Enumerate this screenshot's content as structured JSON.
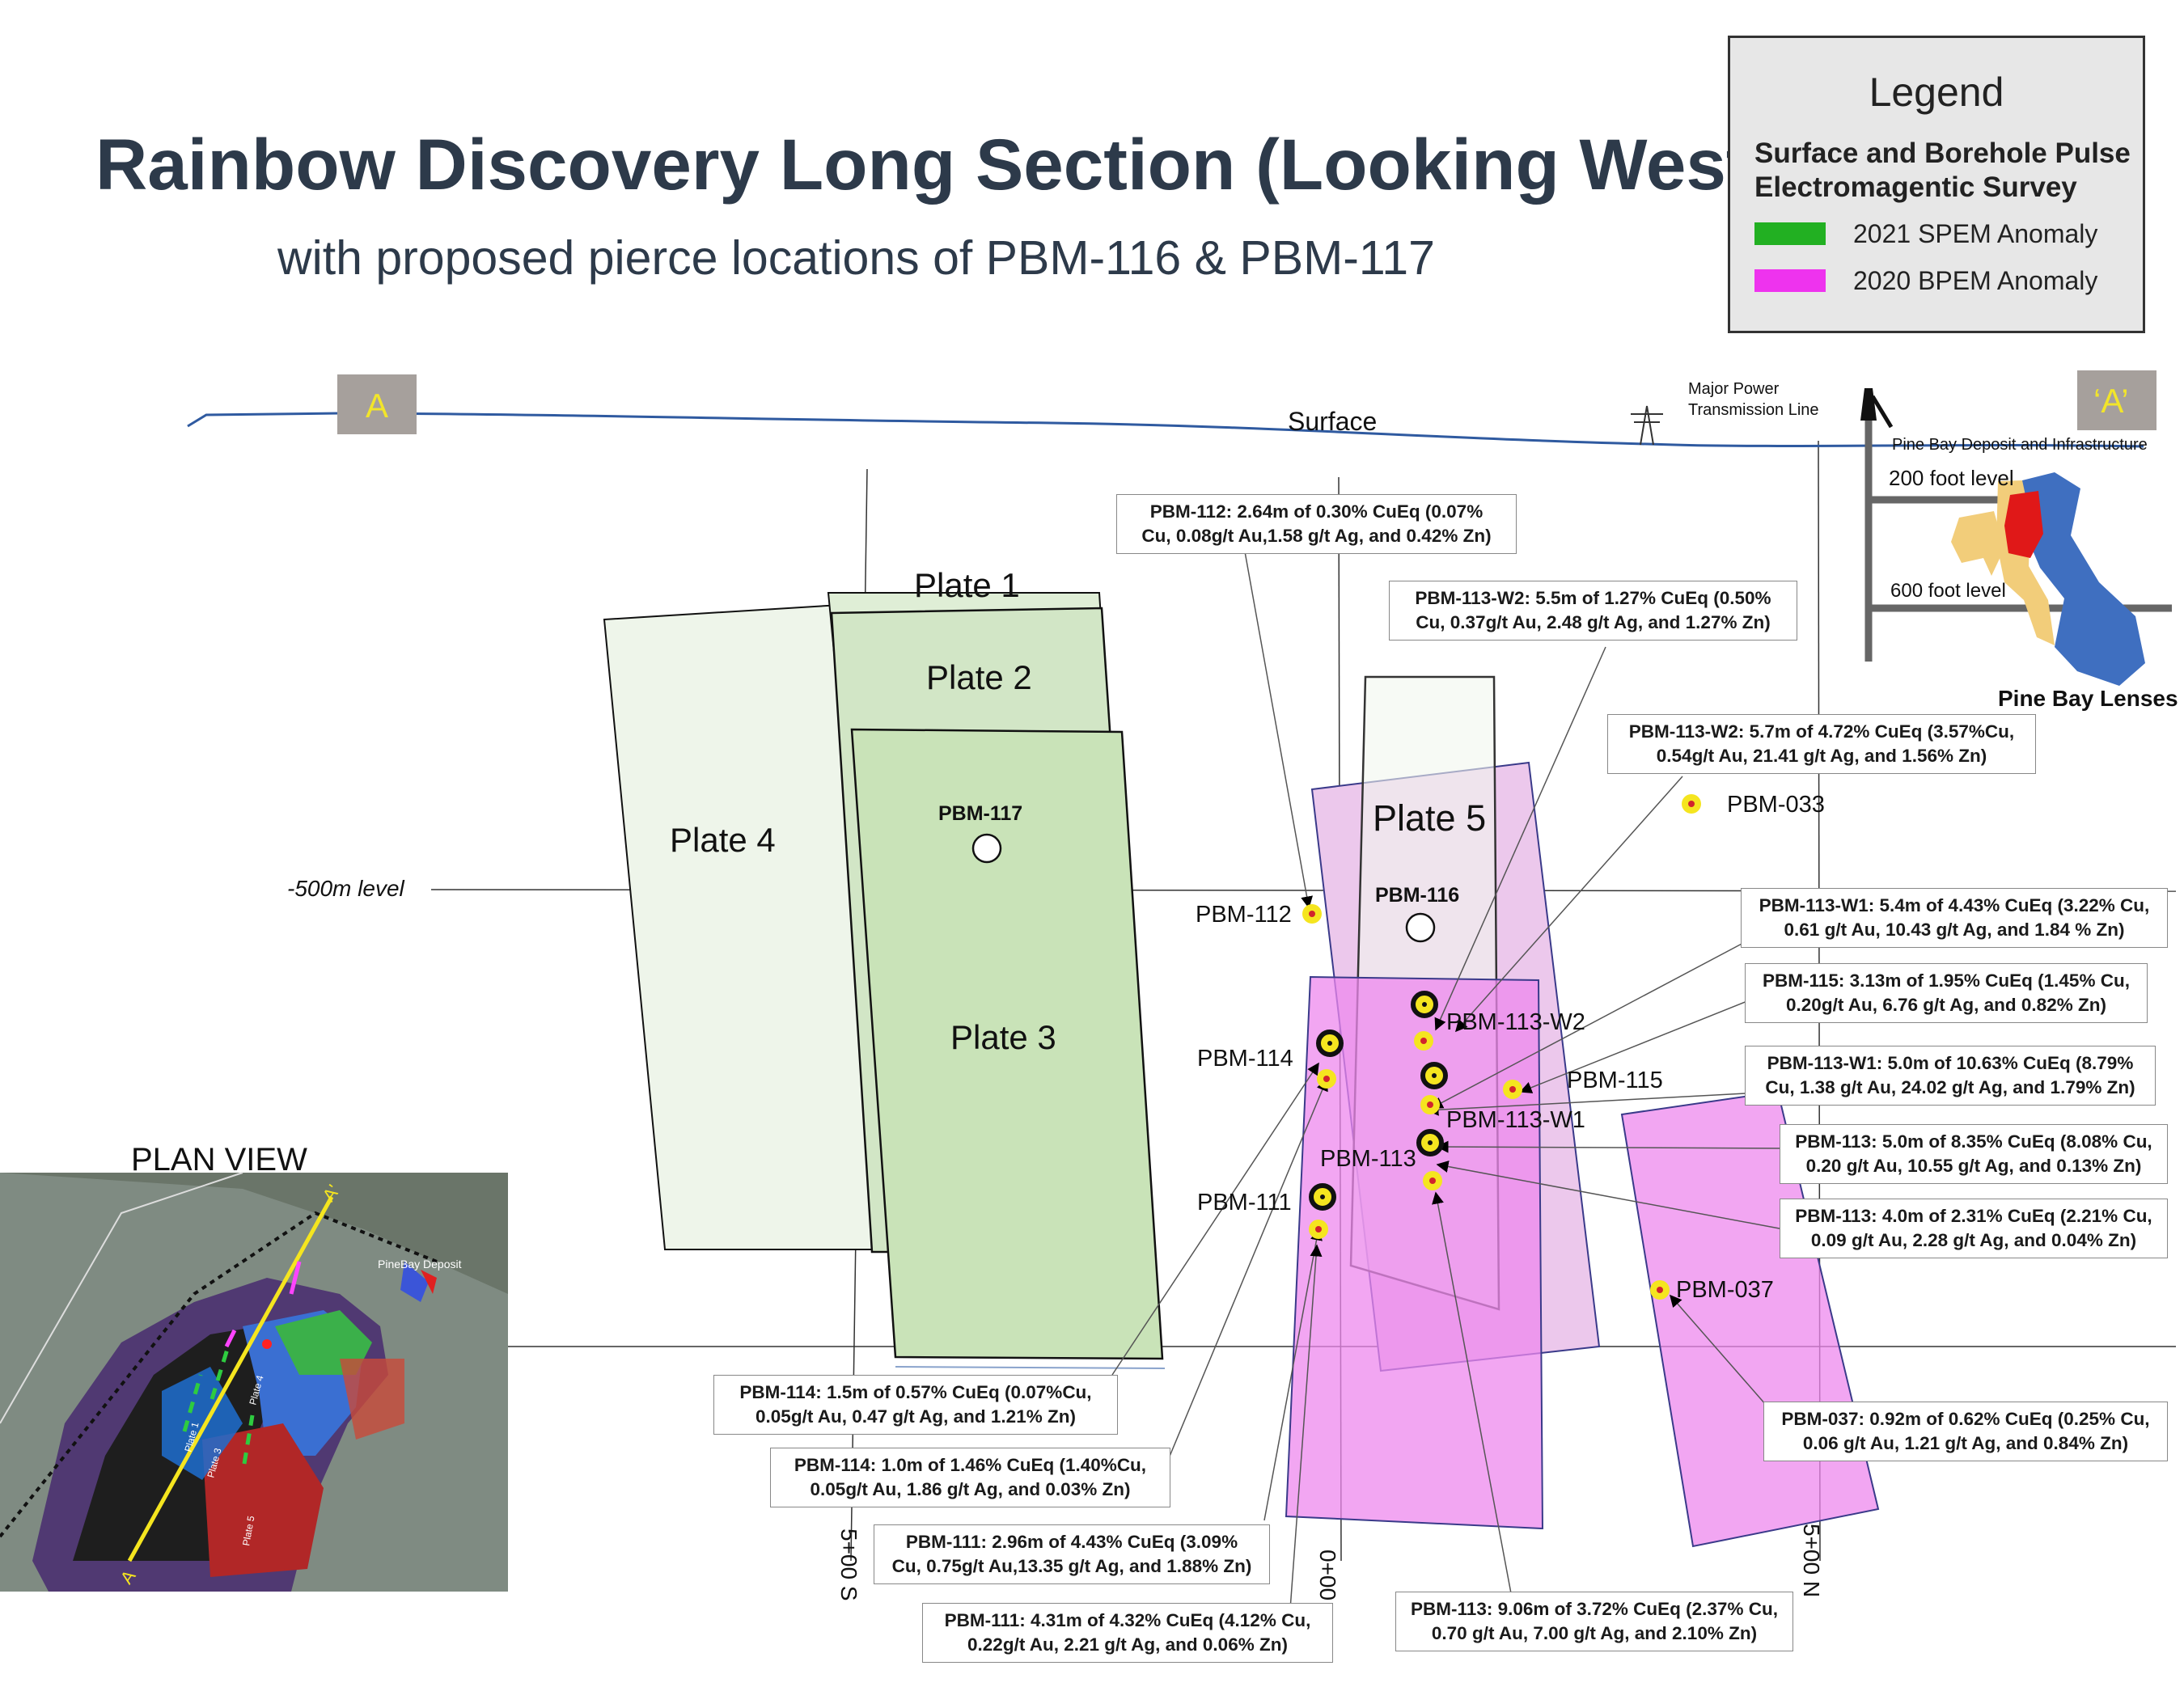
{
  "title": "Rainbow Discovery Long Section (Looking West)",
  "subtitle": "with proposed pierce locations of PBM-116 &  PBM-117",
  "legend": {
    "title": "Legend",
    "subtitle": "Surface and Borehole Pulse Electromagentic Survey",
    "items": [
      {
        "label": "2021 SPEM Anomaly",
        "color": "#22b022"
      },
      {
        "label": "2020 BPEM Anomaly",
        "color": "#ee33ee"
      }
    ]
  },
  "section": {
    "point_a": "A",
    "point_a_prime": "‘A’",
    "surface_label": "Surface",
    "power_line_label_1": "Major Power",
    "power_line_label_2": "Transmission Line",
    "level_label": "-500m level",
    "grid_labels": [
      "5+00 S",
      "0+00",
      "5+00 N"
    ]
  },
  "plates": {
    "plate1": "Plate 1",
    "plate2": "Plate 2",
    "plate3": "Plate 3",
    "plate4": "Plate 4",
    "plate5": "Plate 5"
  },
  "proposed": {
    "pbm117": "PBM-117",
    "pbm116": "PBM-116"
  },
  "holes": {
    "pbm112": "PBM-112",
    "pbm114": "PBM-114",
    "pbm111": "PBM-111",
    "pbm113": "PBM-113",
    "pbm113w2": "PBM-113-W2",
    "pbm113w1": "PBM-113-W1",
    "pbm115": "PBM-115",
    "pbm033": "PBM-033",
    "pbm037": "PBM-037"
  },
  "pine_bay": {
    "deposit_label": "Pine Bay Deposit and Infrastructure",
    "level_200": "200 foot level",
    "level_600": "600 foot level",
    "lenses_label": "Pine Bay Lenses"
  },
  "plan_view": {
    "title": "PLAN VIEW",
    "deposit_label": "PineBay Deposit",
    "point_a": "A",
    "point_a_prime": "A'",
    "plate_labels": [
      "Plate 1",
      "Plate 3",
      "Plate 4",
      "Plate 5"
    ]
  },
  "callouts": {
    "c112": [
      "PBM-112: 2.64m of 0.30% CuEq (0.07%",
      "Cu, 0.08g/t Au,1.58 g/t Ag, and 0.42% Zn)"
    ],
    "c113w2a": [
      "PBM-113-W2: 5.5m of 1.27% CuEq (0.50%",
      "Cu, 0.37g/t Au, 2.48 g/t Ag, and 1.27% Zn)"
    ],
    "c113w2b": [
      "PBM-113-W2: 5.7m of 4.72% CuEq (3.57%Cu,",
      "0.54g/t Au, 21.41 g/t Ag, and 1.56% Zn)"
    ],
    "c113w1a": [
      "PBM-113-W1: 5.4m of 4.43% CuEq (3.22% Cu,",
      "0.61 g/t Au, 10.43 g/t Ag, and 1.84 % Zn)"
    ],
    "c115": [
      "PBM-115: 3.13m of 1.95% CuEq (1.45% Cu,",
      "0.20g/t Au, 6.76 g/t Ag, and 0.82% Zn)"
    ],
    "c113w1b": [
      "PBM-113-W1: 5.0m of 10.63% CuEq (8.79%",
      "Cu, 1.38 g/t Au, 24.02 g/t Ag, and 1.79% Zn)"
    ],
    "c113a": [
      "PBM-113: 5.0m of 8.35% CuEq (8.08% Cu,",
      "0.20 g/t Au, 10.55 g/t Ag, and 0.13% Zn)"
    ],
    "c113b": [
      "PBM-113: 4.0m of 2.31% CuEq (2.21% Cu,",
      "0.09 g/t Au, 2.28 g/t Ag, and 0.04% Zn)"
    ],
    "c037": [
      "PBM-037: 0.92m of 0.62% CuEq (0.25% Cu,",
      "0.06 g/t Au, 1.21 g/t Ag, and 0.84% Zn)"
    ],
    "c114a": [
      "PBM-114: 1.5m of 0.57% CuEq (0.07%Cu,",
      "0.05g/t Au, 0.47 g/t Ag, and 1.21% Zn)"
    ],
    "c114b": [
      "PBM-114: 1.0m of 1.46% CuEq (1.40%Cu,",
      "0.05g/t Au, 1.86 g/t Ag, and 0.03% Zn)"
    ],
    "c111a": [
      "PBM-111: 2.96m of 4.43% CuEq (3.09%",
      "Cu, 0.75g/t Au,13.35 g/t Ag, and 1.88% Zn)"
    ],
    "c111b": [
      "PBM-111: 4.31m of 4.32% CuEq (4.12% Cu,",
      "0.22g/t Au, 2.21 g/t Ag, and 0.06% Zn)"
    ],
    "c113c": [
      "PBM-113: 9.06m of 3.72% CuEq (2.37% Cu,",
      "0.70 g/t Au, 7.00 g/t Ag, and 2.10% Zn)"
    ]
  }
}
